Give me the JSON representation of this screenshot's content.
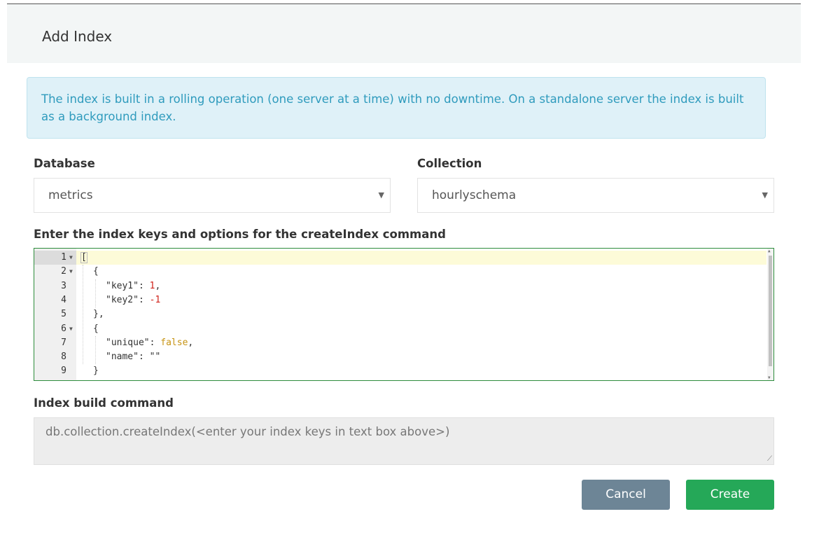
{
  "modal": {
    "title": "Add Index",
    "info_text": "The index is built in a rolling operation (one server at a time) with no downtime. On a standalone server the index is built as a background index."
  },
  "database": {
    "label": "Database",
    "selected": "metrics"
  },
  "collection": {
    "label": "Collection",
    "selected": "hourlyschema"
  },
  "editor": {
    "label": "Enter the index keys and options for the createIndex command",
    "lines": [
      {
        "num": "1",
        "fold": true,
        "tokens": [
          {
            "t": "[",
            "c": "punc-cursor"
          }
        ]
      },
      {
        "num": "2",
        "fold": true,
        "indent": 1,
        "tokens": [
          {
            "t": "{",
            "c": "punc"
          }
        ]
      },
      {
        "num": "3",
        "fold": false,
        "indent": 2,
        "tokens": [
          {
            "t": "\"key1\"",
            "c": "str"
          },
          {
            "t": ": ",
            "c": "punc"
          },
          {
            "t": "1",
            "c": "num"
          },
          {
            "t": ",",
            "c": "punc"
          }
        ]
      },
      {
        "num": "4",
        "fold": false,
        "indent": 2,
        "tokens": [
          {
            "t": "\"key2\"",
            "c": "str"
          },
          {
            "t": ": ",
            "c": "punc"
          },
          {
            "t": "-1",
            "c": "num"
          }
        ]
      },
      {
        "num": "5",
        "fold": false,
        "indent": 1,
        "tokens": [
          {
            "t": "},",
            "c": "punc"
          }
        ]
      },
      {
        "num": "6",
        "fold": true,
        "indent": 1,
        "tokens": [
          {
            "t": "{",
            "c": "punc"
          }
        ]
      },
      {
        "num": "7",
        "fold": false,
        "indent": 2,
        "tokens": [
          {
            "t": "\"unique\"",
            "c": "str"
          },
          {
            "t": ": ",
            "c": "punc"
          },
          {
            "t": "false",
            "c": "bool"
          },
          {
            "t": ",",
            "c": "punc"
          }
        ]
      },
      {
        "num": "8",
        "fold": false,
        "indent": 2,
        "tokens": [
          {
            "t": "\"name\"",
            "c": "str"
          },
          {
            "t": ": ",
            "c": "punc"
          },
          {
            "t": "\"\"",
            "c": "str"
          }
        ]
      },
      {
        "num": "9",
        "fold": false,
        "indent": 1,
        "tokens": [
          {
            "t": "}",
            "c": "punc"
          }
        ]
      }
    ]
  },
  "command": {
    "label": "Index build command",
    "value": "db.collection.createIndex(<enter your index keys in text box above>)"
  },
  "buttons": {
    "cancel": "Cancel",
    "create": "Create"
  },
  "colors": {
    "info_bg": "#dff1f8",
    "info_text": "#2f9bbd",
    "cancel": "#6d8596",
    "create": "#25a858",
    "editor_border": "#2d8c3c"
  },
  "icons": {
    "select_caret": "caret-down-icon",
    "fold": "fold-arrow-icon",
    "resize": "resize-grip-icon"
  }
}
